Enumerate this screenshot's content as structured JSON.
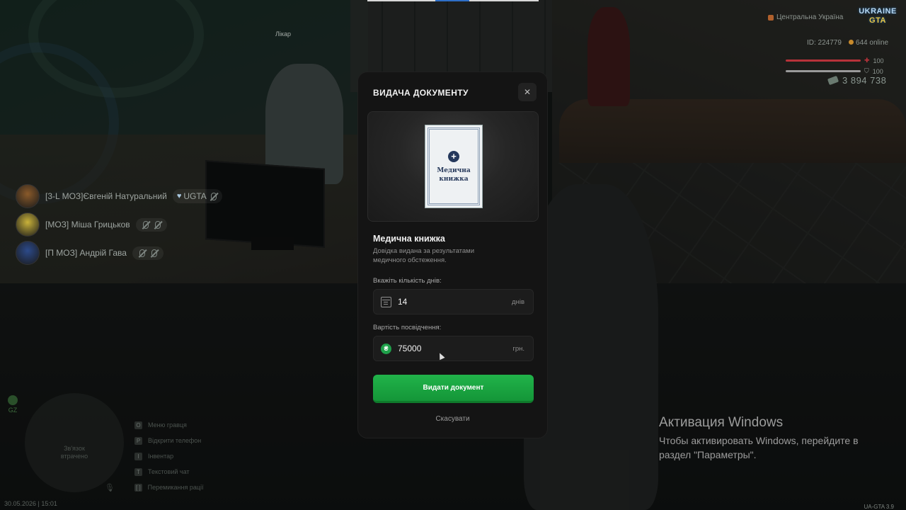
{
  "hud": {
    "region": "Центральна Україна",
    "logo_line1": "UKRAINE",
    "logo_line2": "GTA",
    "player_id": "ID: 224779",
    "online": "644 online",
    "health": "100",
    "armor": "100",
    "money": "3 894 738",
    "health_level": 1.0,
    "armor_level": 1.0,
    "health_color": "#b8323a",
    "armor_color": "#9a9a9a"
  },
  "npc_label": "Лікар",
  "voice_chat": [
    {
      "name": "[3-L МОЗ]Євгеній Натуральний",
      "badge": "UGTA",
      "avatar_color": "#8a5a2a"
    },
    {
      "name": "[МОЗ] Міша Грицьков",
      "badge": "",
      "avatar_color": "#c9b23a"
    },
    {
      "name": "[П МОЗ] Андрій Гава",
      "badge": "",
      "avatar_color": "#2c4a8a"
    }
  ],
  "minimap": {
    "status_line1": "Зв'язок",
    "status_line2": "втрачено",
    "gz": "GZ"
  },
  "keybinds": [
    {
      "key": "O",
      "label": "Меню гравця"
    },
    {
      "key": "P",
      "label": "Відкрити телефон"
    },
    {
      "key": "I",
      "label": "Інвентар"
    },
    {
      "key": "T",
      "label": "Текстовий чат"
    },
    {
      "key": "[ ]",
      "label": "Перемикання рації"
    }
  ],
  "timestamp": "30.05.2026 | 15:01",
  "version": "UA-GTA 3.9",
  "modal": {
    "title": "ВИДАЧА ДОКУМЕНТУ",
    "close_label": "✕",
    "document_cover_title": "Медична книжка",
    "document_name": "Медична книжка",
    "document_description": "Довідка видана за результатами медичного обстеження.",
    "days_label": "Вкажіть кількість днів:",
    "days_value": "14",
    "days_unit": "днів",
    "price_label": "Вартість посвідчення:",
    "price_value": "75000",
    "price_unit": "грн.",
    "currency_symbol": "₴",
    "issue_button": "Видати документ",
    "cancel_button": "Скасувати",
    "accent_color": "#1fa04a"
  },
  "windows_activation": {
    "title": "Активация Windows",
    "text": "Чтобы активировать Windows, перейдите в раздел \"Параметры\"."
  }
}
